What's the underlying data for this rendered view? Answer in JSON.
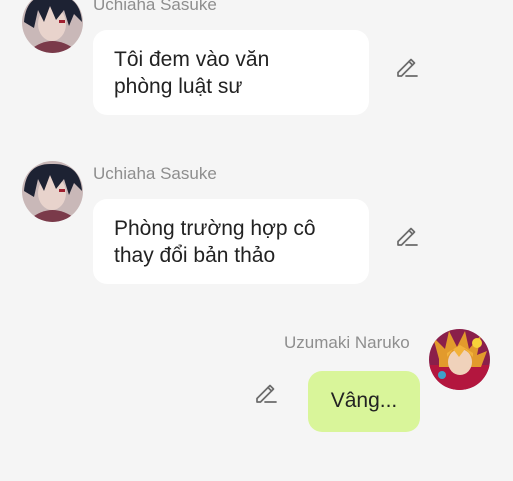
{
  "colors": {
    "background": "#f5f5f5",
    "incoming_bubble": "#ffffff",
    "outgoing_bubble": "#d9f59a",
    "sender_text": "#8e8e8e",
    "message_text": "#222222",
    "edit_icon": "#6b6b6b"
  },
  "messages": [
    {
      "direction": "incoming",
      "sender": "Uchiaha Sasuke",
      "avatar_icon": "sasuke-avatar",
      "lines": [
        "Tôi đem vào văn",
        "phòng luật sư"
      ],
      "action_icon": "edit-pencil-icon"
    },
    {
      "direction": "incoming",
      "sender": "Uchiaha Sasuke",
      "avatar_icon": "sasuke-avatar",
      "lines": [
        "Phòng trường hợp cô",
        "thay đổi bản thảo"
      ],
      "action_icon": "edit-pencil-icon"
    },
    {
      "direction": "outgoing",
      "sender": "Uzumaki Naruko",
      "avatar_icon": "naruko-avatar",
      "lines": [
        "Vâng..."
      ],
      "action_icon": "edit-pencil-icon"
    }
  ]
}
